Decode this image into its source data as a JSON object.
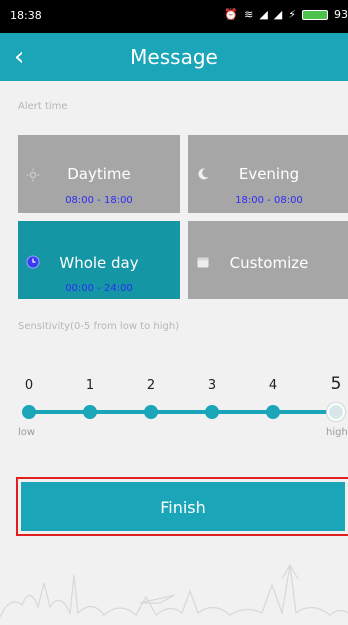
{
  "status_bar": {
    "time": "18:38",
    "battery": "93"
  },
  "header": {
    "title": "Message",
    "back_icon": "chevron-left-icon"
  },
  "alert_time": {
    "label": "Alert time",
    "options": [
      {
        "name": "Daytime",
        "range": "08:00 - 18:00",
        "icon": "sun-icon",
        "selected": false
      },
      {
        "name": "Evening",
        "range": "18:00 - 08:00",
        "icon": "moon-icon",
        "selected": false
      },
      {
        "name": "Whole day",
        "range": "00:00 - 24:00",
        "icon": "clock-icon",
        "selected": true
      },
      {
        "name": "Customize",
        "range": "",
        "icon": "calendar-icon",
        "selected": false
      }
    ]
  },
  "sensitivity": {
    "label": "Sensitivity(0-5 from low to high)",
    "levels": [
      "0",
      "1",
      "2",
      "3",
      "4",
      "5"
    ],
    "selected_level": 5,
    "low_label": "low",
    "high_label": "high"
  },
  "finish_label": "Finish",
  "colors": {
    "accent": "#1aa5b8",
    "tile_inactive": "#a6a6a6",
    "highlight_border": "#e02020"
  }
}
